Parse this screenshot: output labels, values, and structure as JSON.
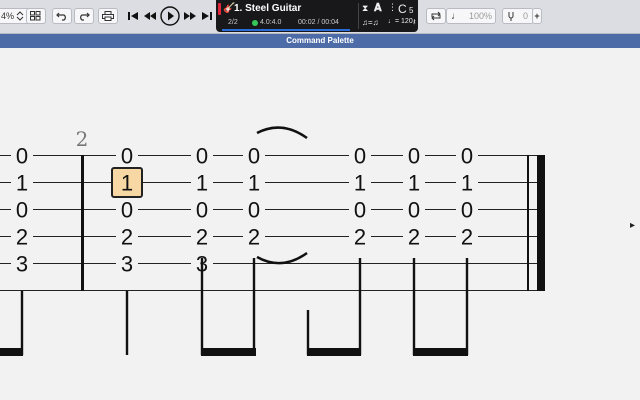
{
  "toolbar": {
    "zoom_value": "4%",
    "tempo_display": "100%",
    "pitch_value": "0",
    "plus_label": "+"
  },
  "lcd": {
    "track_name": "1. Steel Guitar",
    "time_signature": "2/2",
    "bar_position": "4.0:4.0",
    "time_elapsed": "00:02 / 00:04",
    "tempo_equation": "♫=♫",
    "tempo_bpm": "♩= 120",
    "key_letter": "C",
    "key_number": "5"
  },
  "panel": {
    "title": "Command Palette"
  },
  "tab": {
    "bar_number": "2",
    "columns": [
      [
        "0",
        "1",
        "0",
        "2",
        "3"
      ],
      [
        "0",
        "1",
        "0",
        "2",
        "3"
      ],
      [
        "0",
        "1",
        "0",
        "2",
        ""
      ],
      [
        "0",
        "1",
        "0",
        "2",
        ""
      ],
      [
        "0",
        "1",
        "0",
        "2",
        ""
      ],
      [
        "0",
        "1",
        "0",
        "2",
        ""
      ],
      [
        "0",
        "1",
        "0",
        "2",
        ""
      ]
    ],
    "left_partial": [
      "0",
      "1",
      "0",
      "2",
      "3"
    ]
  },
  "colors": {
    "toolbar_bg": "#dcdde2",
    "titlebar_bg": "#4d6ca7",
    "selection_fill": "#f7d7a3",
    "lcd_bg": "#18181a"
  }
}
